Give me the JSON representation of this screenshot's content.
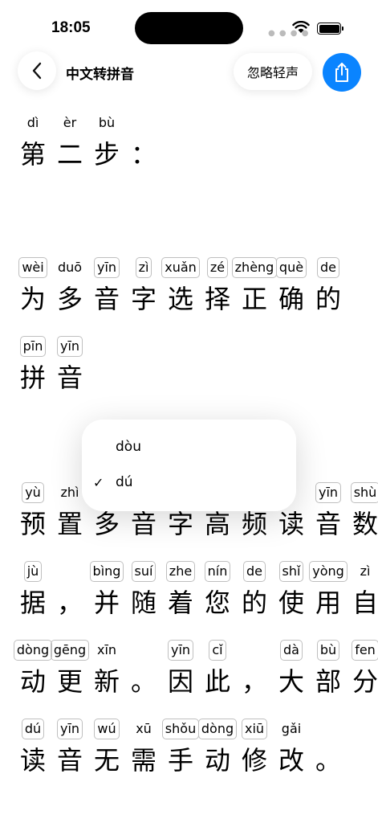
{
  "status": {
    "time": "18:05"
  },
  "nav": {
    "title": "中文转拼音",
    "ignore_label": "忽略轻声"
  },
  "popup": {
    "options": [
      {
        "label": "dòu",
        "selected": false
      },
      {
        "label": "dú",
        "selected": true
      }
    ]
  },
  "lines": [
    [
      {
        "py": "dì",
        "hz": "第",
        "box": false
      },
      {
        "py": "èr",
        "hz": "二",
        "box": false
      },
      {
        "py": "bù",
        "hz": "步",
        "box": false
      },
      {
        "py": "",
        "hz": "：",
        "box": false
      }
    ],
    [
      {
        "py": "wèi",
        "hz": "为",
        "box": true
      },
      {
        "py": "duō",
        "hz": "多",
        "box": false
      },
      {
        "py": "yīn",
        "hz": "音",
        "box": true
      },
      {
        "py": "zì",
        "hz": "字",
        "box": true
      },
      {
        "py": "xuǎn",
        "hz": "选",
        "box": true
      },
      {
        "py": "zé",
        "hz": "择",
        "box": true
      },
      {
        "py": "zhèng",
        "hz": "正",
        "box": true
      },
      {
        "py": "què",
        "hz": "确",
        "box": true
      },
      {
        "py": "de",
        "hz": "的",
        "box": true
      }
    ],
    [
      {
        "py": "pīn",
        "hz": "拼",
        "box": true
      },
      {
        "py": "yīn",
        "hz": "音",
        "box": true
      }
    ],
    [
      {
        "py": "yù",
        "hz": "预",
        "box": true
      },
      {
        "py": "zhì",
        "hz": "置",
        "box": false
      },
      {
        "py": "",
        "hz": "多",
        "box": false
      },
      {
        "py": "",
        "hz": "音",
        "box": false
      },
      {
        "py": "",
        "hz": "字",
        "box": false
      },
      {
        "py": "",
        "hz": "高",
        "box": false
      },
      {
        "py": "",
        "hz": "频",
        "box": false
      },
      {
        "py": "",
        "hz": "读",
        "box": false
      },
      {
        "py": "yīn",
        "hz": "音",
        "box": true
      },
      {
        "py": "shù",
        "hz": "数",
        "box": true
      }
    ],
    [
      {
        "py": "jù",
        "hz": "据",
        "box": true
      },
      {
        "py": "",
        "hz": "，",
        "box": false
      },
      {
        "py": "bìng",
        "hz": "并",
        "box": true
      },
      {
        "py": "suí",
        "hz": "随",
        "box": true
      },
      {
        "py": "zhe",
        "hz": "着",
        "box": true
      },
      {
        "py": "nín",
        "hz": "您",
        "box": true
      },
      {
        "py": "de",
        "hz": "的",
        "box": true
      },
      {
        "py": "shǐ",
        "hz": "使",
        "box": true
      },
      {
        "py": "yòng",
        "hz": "用",
        "box": true
      },
      {
        "py": "zì",
        "hz": "自",
        "box": false
      }
    ],
    [
      {
        "py": "dòng",
        "hz": "动",
        "box": true
      },
      {
        "py": "gēng",
        "hz": "更",
        "box": true
      },
      {
        "py": "xīn",
        "hz": "新",
        "box": false
      },
      {
        "py": "",
        "hz": "。",
        "box": false
      },
      {
        "py": "yīn",
        "hz": "因",
        "box": true
      },
      {
        "py": "cǐ",
        "hz": "此",
        "box": true
      },
      {
        "py": "",
        "hz": "，",
        "box": false
      },
      {
        "py": "dà",
        "hz": "大",
        "box": true
      },
      {
        "py": "bù",
        "hz": "部",
        "box": true
      },
      {
        "py": "fen",
        "hz": "分",
        "box": true
      }
    ],
    [
      {
        "py": "dú",
        "hz": "读",
        "box": true
      },
      {
        "py": "yīn",
        "hz": "音",
        "box": true
      },
      {
        "py": "wú",
        "hz": "无",
        "box": true
      },
      {
        "py": "xū",
        "hz": "需",
        "box": false
      },
      {
        "py": "shǒu",
        "hz": "手",
        "box": true
      },
      {
        "py": "dòng",
        "hz": "动",
        "box": true
      },
      {
        "py": "xiū",
        "hz": "修",
        "box": true
      },
      {
        "py": "gǎi",
        "hz": "改",
        "box": false
      },
      {
        "py": "",
        "hz": "。",
        "box": false
      }
    ]
  ],
  "colors": {
    "accent": "#0a84ff",
    "box_border": "#bfbfbf"
  },
  "icons": {
    "back": "chevron-left-icon",
    "share": "share-icon",
    "check": "checkmark-icon"
  }
}
